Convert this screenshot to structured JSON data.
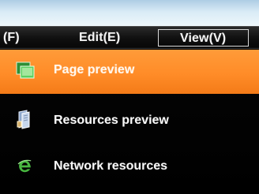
{
  "menubar": {
    "items": [
      {
        "label": "(F)"
      },
      {
        "label": "Edit(E)"
      },
      {
        "label": "View(V)"
      }
    ]
  },
  "dropdown": {
    "items": [
      {
        "label": "Page preview",
        "icon": "page-preview-icon",
        "selected": true
      },
      {
        "label": "Resources preview",
        "icon": "resources-preview-icon",
        "selected": false
      },
      {
        "label": "Network resources",
        "icon": "network-resources-icon",
        "selected": false
      }
    ]
  },
  "colors": {
    "highlight": "#ff8c28",
    "menubar": "#101010",
    "dropdown": "#000000",
    "text": "#f7f7f7",
    "page_icon": "#44b044",
    "resources_icon": "#9bb9df",
    "network_icon": "#48b840"
  }
}
